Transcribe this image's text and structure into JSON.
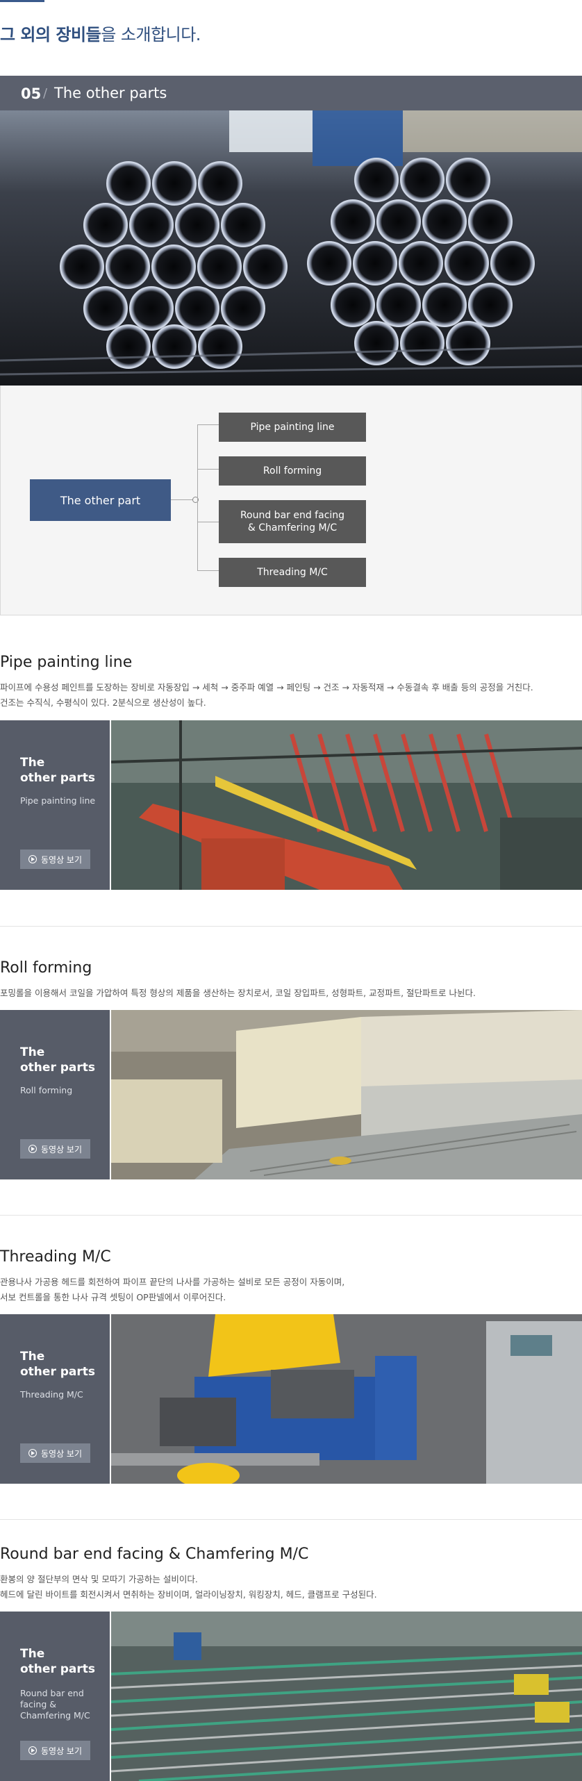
{
  "intro": {
    "title_bold": "그 외의 장비들",
    "title_rest": "을 소개합니다."
  },
  "section05": {
    "number": "05",
    "separator": "/",
    "name": "The other parts"
  },
  "diagram": {
    "main_label": "The other part",
    "items": [
      "Pipe painting line",
      "Roll forming",
      "Round bar end facing\n& Chamfering M/C",
      "Threading M/C"
    ]
  },
  "sections": [
    {
      "title": "Pipe painting line",
      "desc": [
        "파이프에 수용성 페인트를 도장하는 장비로 자동장입 → 세척 → 중주파 예열 → 페인팅 → 건조 → 자동적재 → 수동결속 후 배출 등의 공정을 거친다.",
        "건조는 수직식, 수평식이 있다. 2분식으로 생산성이 높다."
      ],
      "card_title": "The\nother parts",
      "card_sub": "Pipe painting line",
      "video_label": "동영상 보기"
    },
    {
      "title": "Roll forming",
      "desc": [
        "포밍롤을 이용해서 코일을 가압하여 특정 형상의 제품을 생산하는 장치로서, 코일 장입파트, 성형파트, 교정파트, 절단파트로 나뉜다."
      ],
      "card_title": "The\nother parts",
      "card_sub": "Roll forming",
      "video_label": "동영상 보기"
    },
    {
      "title": "Threading M/C",
      "desc": [
        "관용나사 가공용 헤드를 회전하여 파이프 끝단의 나사를 가공하는 설비로 모든 공정이 자동이며,",
        "서보 컨트롤을 통한 나사 규격 셋팅이 OP판넬에서 이루어진다."
      ],
      "card_title": "The\nother parts",
      "card_sub": "Threading M/C",
      "video_label": "동영상 보기"
    },
    {
      "title": "Round bar end facing & Chamfering M/C",
      "desc": [
        "환봉의 양 절단부의 면삭 및 모따기 가공하는 설비이다.",
        "헤드에 달린 바이트를 회전시켜서 면취하는 장비이며, 얼라이닝장치, 워킹장치, 헤드, 클램프로 구성된다."
      ],
      "card_title": "The\nother parts",
      "card_sub": "Round bar end\nfacing &\nChamfering M/C",
      "video_label": "동영상 보기"
    }
  ],
  "colors": {
    "accent": "#3f5a86",
    "bar": "#5b606d",
    "side": "#575c68",
    "item": "#585858"
  }
}
